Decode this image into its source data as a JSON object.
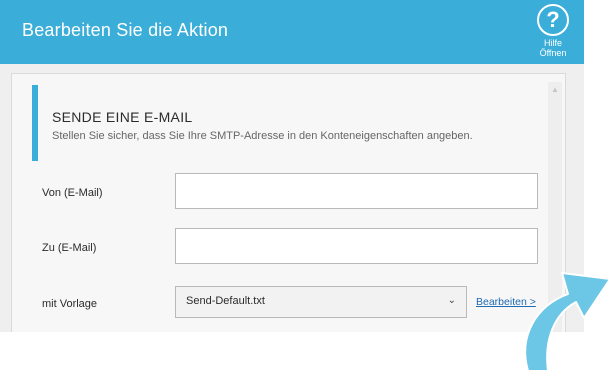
{
  "header": {
    "title": "Bearbeiten Sie die Aktion",
    "help_symbol": "?",
    "help_label": "Hilfe Öffnen"
  },
  "section": {
    "title": "SENDE EINE E-MAIL",
    "subtitle": "Stellen Sie sicher, dass Sie Ihre SMTP-Adresse in den Konteneigenschaften angeben."
  },
  "form": {
    "from_label": "Von (E-Mail)",
    "from_value": "",
    "to_label": "Zu (E-Mail)",
    "to_value": "",
    "template_label": "mit Vorlage",
    "template_value": "Send-Default.txt",
    "edit_link": "Bearbeiten >"
  },
  "icons": {
    "help": "question-circle-icon",
    "dropdown": "chevron-down-icon",
    "scroll_up": "scroll-up-arrow-icon",
    "decoration": "curved-arrow-icon"
  },
  "colors": {
    "header_bg": "#3aaed8",
    "accent": "#3aaed8",
    "link": "#1f6ab1",
    "arrow": "#6cc6e6"
  }
}
